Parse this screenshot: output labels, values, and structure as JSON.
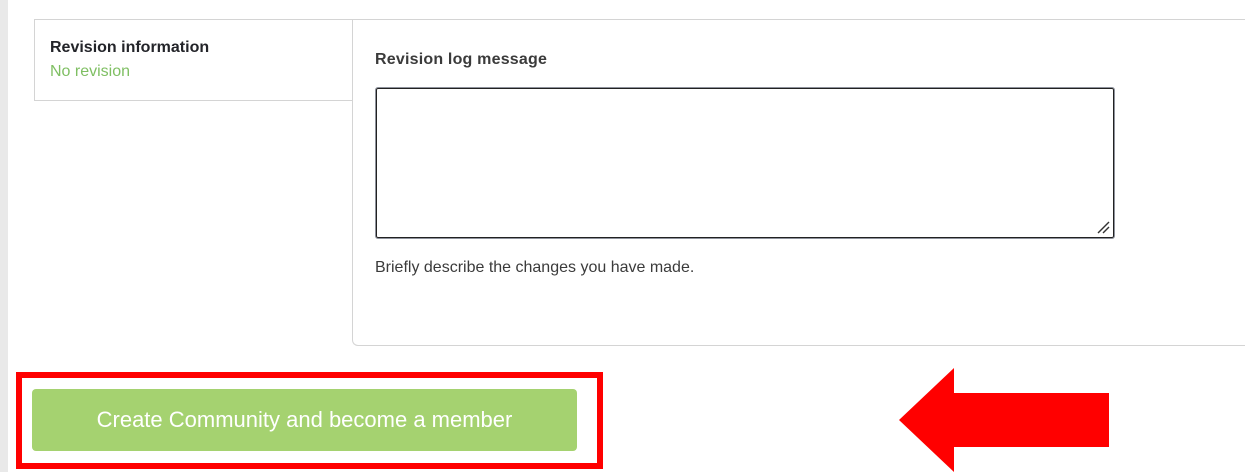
{
  "revision_tab": {
    "title": "Revision information",
    "summary": "No revision"
  },
  "revision_log": {
    "label": "Revision log message",
    "value": "",
    "description": "Briefly describe the changes you have made."
  },
  "actions": {
    "submit_label": "Create Community and become a member"
  },
  "colors": {
    "button": "#a5d270",
    "summary_text": "#7fbf63",
    "annotation": "#ff0000"
  },
  "icons": {
    "textarea_resize": "resize-grip-icon",
    "annotation_pointer": "arrow-left-icon"
  }
}
